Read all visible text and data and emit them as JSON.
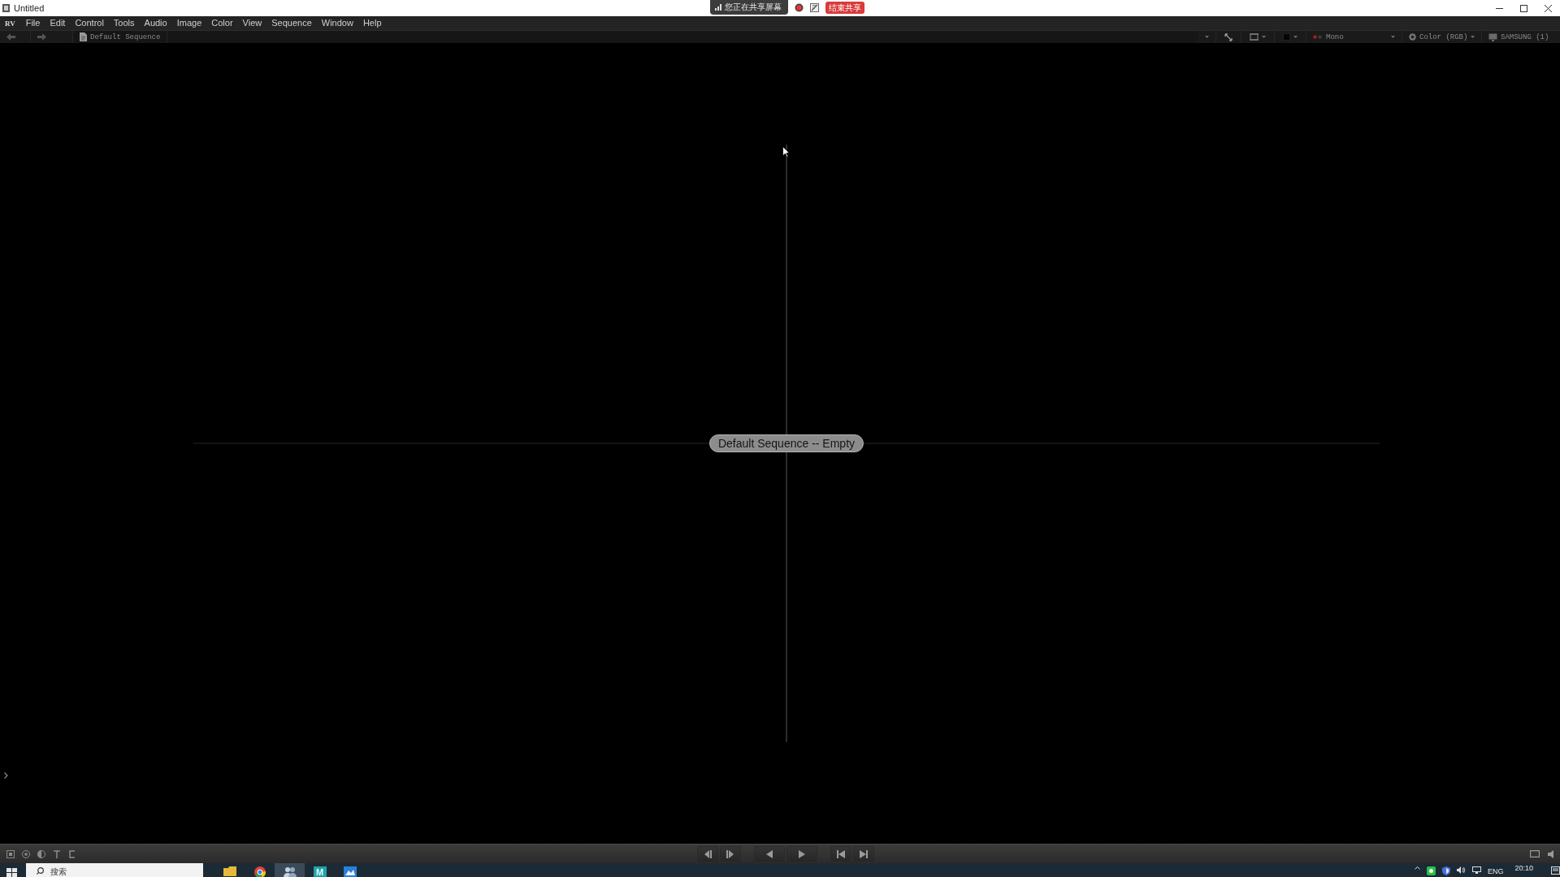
{
  "window": {
    "title": "Untitled"
  },
  "screen_share": {
    "status": "您正在共享屏幕",
    "stop_button": "结束共享"
  },
  "menu_bar": {
    "logo": "RV",
    "items": [
      "File",
      "Edit",
      "Control",
      "Tools",
      "Audio",
      "Image",
      "Color",
      "View",
      "Sequence",
      "Window",
      "Help"
    ]
  },
  "toolbar": {
    "sequence": "Default Sequence",
    "channel": "Mono",
    "color_mode": "Color (RGB)",
    "display": "SAMSUNG (1)"
  },
  "viewer": {
    "message": "Default Sequence -- Empty"
  },
  "taskbar": {
    "search": {
      "placeholder": "搜索"
    },
    "pinned_letter": "M",
    "language": "ENG",
    "time": "20:10"
  }
}
